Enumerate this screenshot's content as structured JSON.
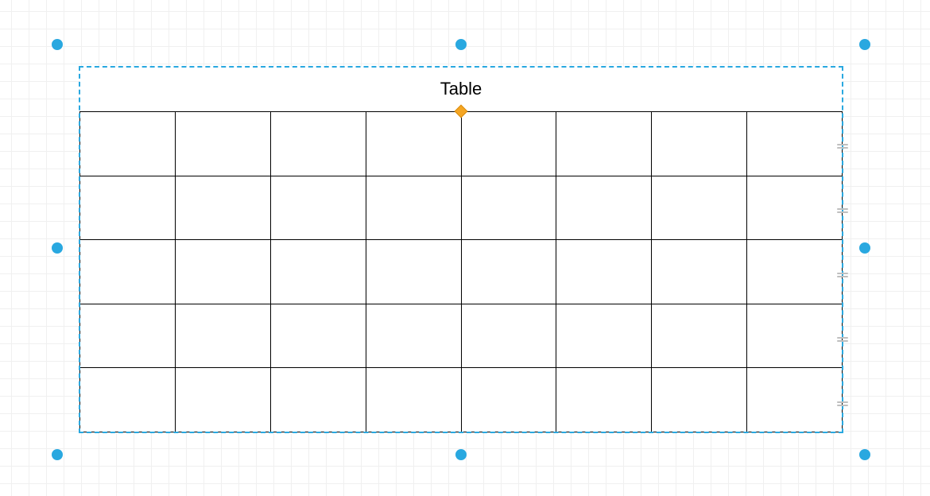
{
  "table": {
    "title": "Table",
    "columns": 8,
    "rows": 5
  },
  "selection": {
    "handle_color": "#29a8e0",
    "outline_color": "#29a8e0",
    "connector_color": "#f5a623"
  }
}
